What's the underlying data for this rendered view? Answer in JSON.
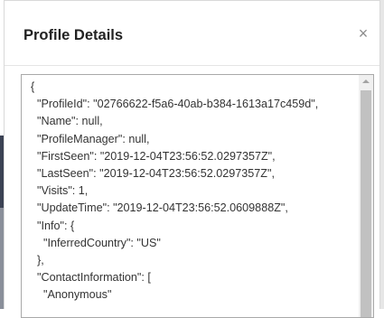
{
  "modal": {
    "title": "Profile Details",
    "close_glyph": "×"
  },
  "json_view": {
    "lines": [
      "{",
      "  \"ProfileId\": \"02766622-f5a6-40ab-b384-1613a17c459d\",",
      "  \"Name\": null,",
      "  \"ProfileManager\": null,",
      "  \"FirstSeen\": \"2019-12-04T23:56:52.0297357Z\",",
      "  \"LastSeen\": \"2019-12-04T23:56:52.0297357Z\",",
      "  \"Visits\": 1,",
      "  \"UpdateTime\": \"2019-12-04T23:56:52.0609888Z\",",
      "  \"Info\": {",
      "    \"InferredCountry\": \"US\"",
      "  },",
      "  \"ContactInformation\": [",
      "    \"Anonymous\""
    ]
  }
}
